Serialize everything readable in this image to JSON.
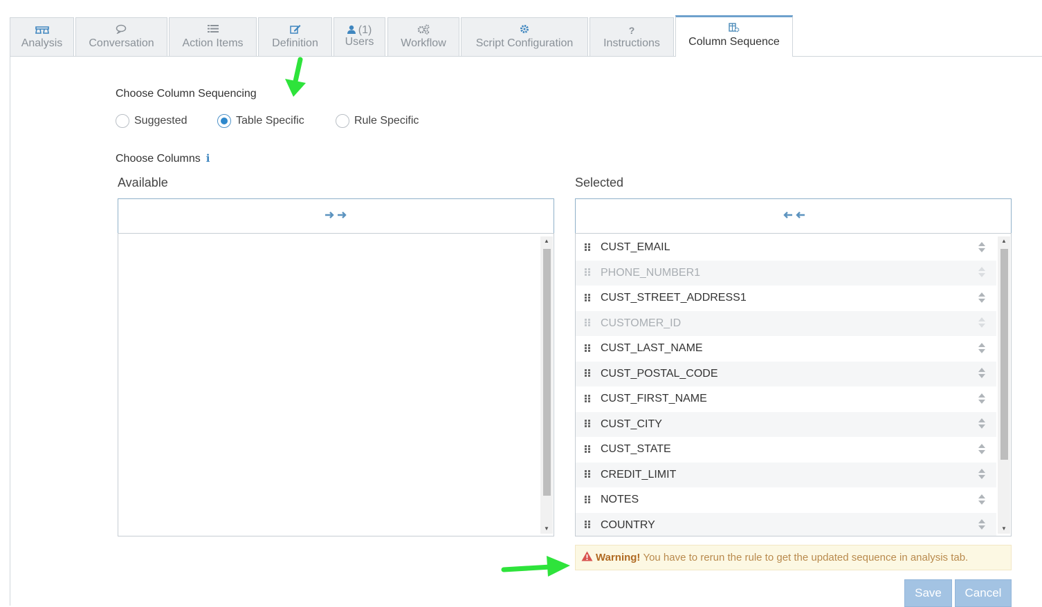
{
  "tabs": [
    {
      "id": "analysis",
      "label": "Analysis",
      "icon": "binoculars-icon"
    },
    {
      "id": "conversation",
      "label": "Conversation",
      "icon": "comments-icon"
    },
    {
      "id": "action_items",
      "label": "Action Items",
      "icon": "list-icon"
    },
    {
      "id": "definition",
      "label": "Definition",
      "icon": "edit-icon"
    },
    {
      "id": "users",
      "label": "Users",
      "count": "(1)",
      "icon": "user-icon"
    },
    {
      "id": "workflow",
      "label": "Workflow",
      "icon": "cogs-icon"
    },
    {
      "id": "script_configuration",
      "label": "Script Configuration",
      "icon": "gear-icon"
    },
    {
      "id": "instructions",
      "label": "Instructions",
      "icon": "question-icon"
    },
    {
      "id": "column_sequence",
      "label": "Column Sequence",
      "icon": "column-settings-icon",
      "active": true
    }
  ],
  "sequencing": {
    "heading": "Choose Column Sequencing",
    "options": [
      {
        "label": "Suggested",
        "checked": false
      },
      {
        "label": "Table Specific",
        "checked": true
      },
      {
        "label": "Rule Specific",
        "checked": false
      }
    ]
  },
  "columns": {
    "heading": "Choose Columns",
    "available_label": "Available",
    "selected_label": "Selected",
    "selected_items": [
      {
        "label": "CUST_EMAIL",
        "disabled": false
      },
      {
        "label": "PHONE_NUMBER1",
        "disabled": true
      },
      {
        "label": "CUST_STREET_ADDRESS1",
        "disabled": false
      },
      {
        "label": "CUSTOMER_ID",
        "disabled": true
      },
      {
        "label": "CUST_LAST_NAME",
        "disabled": false
      },
      {
        "label": "CUST_POSTAL_CODE",
        "disabled": false
      },
      {
        "label": "CUST_FIRST_NAME",
        "disabled": false
      },
      {
        "label": "CUST_CITY",
        "disabled": false
      },
      {
        "label": "CUST_STATE",
        "disabled": false
      },
      {
        "label": "CREDIT_LIMIT",
        "disabled": false
      },
      {
        "label": "NOTES",
        "disabled": false
      },
      {
        "label": "COUNTRY",
        "disabled": false
      }
    ]
  },
  "warning": {
    "title": "Warning!",
    "message": "You have to rerun the rule to get the updated sequence in analysis tab."
  },
  "buttons": {
    "save": "Save",
    "cancel": "Cancel"
  },
  "colors": {
    "accent": "#2e88cc",
    "arrow_annotation": "#2ee33b",
    "warning_bg": "#fcf8e3"
  }
}
